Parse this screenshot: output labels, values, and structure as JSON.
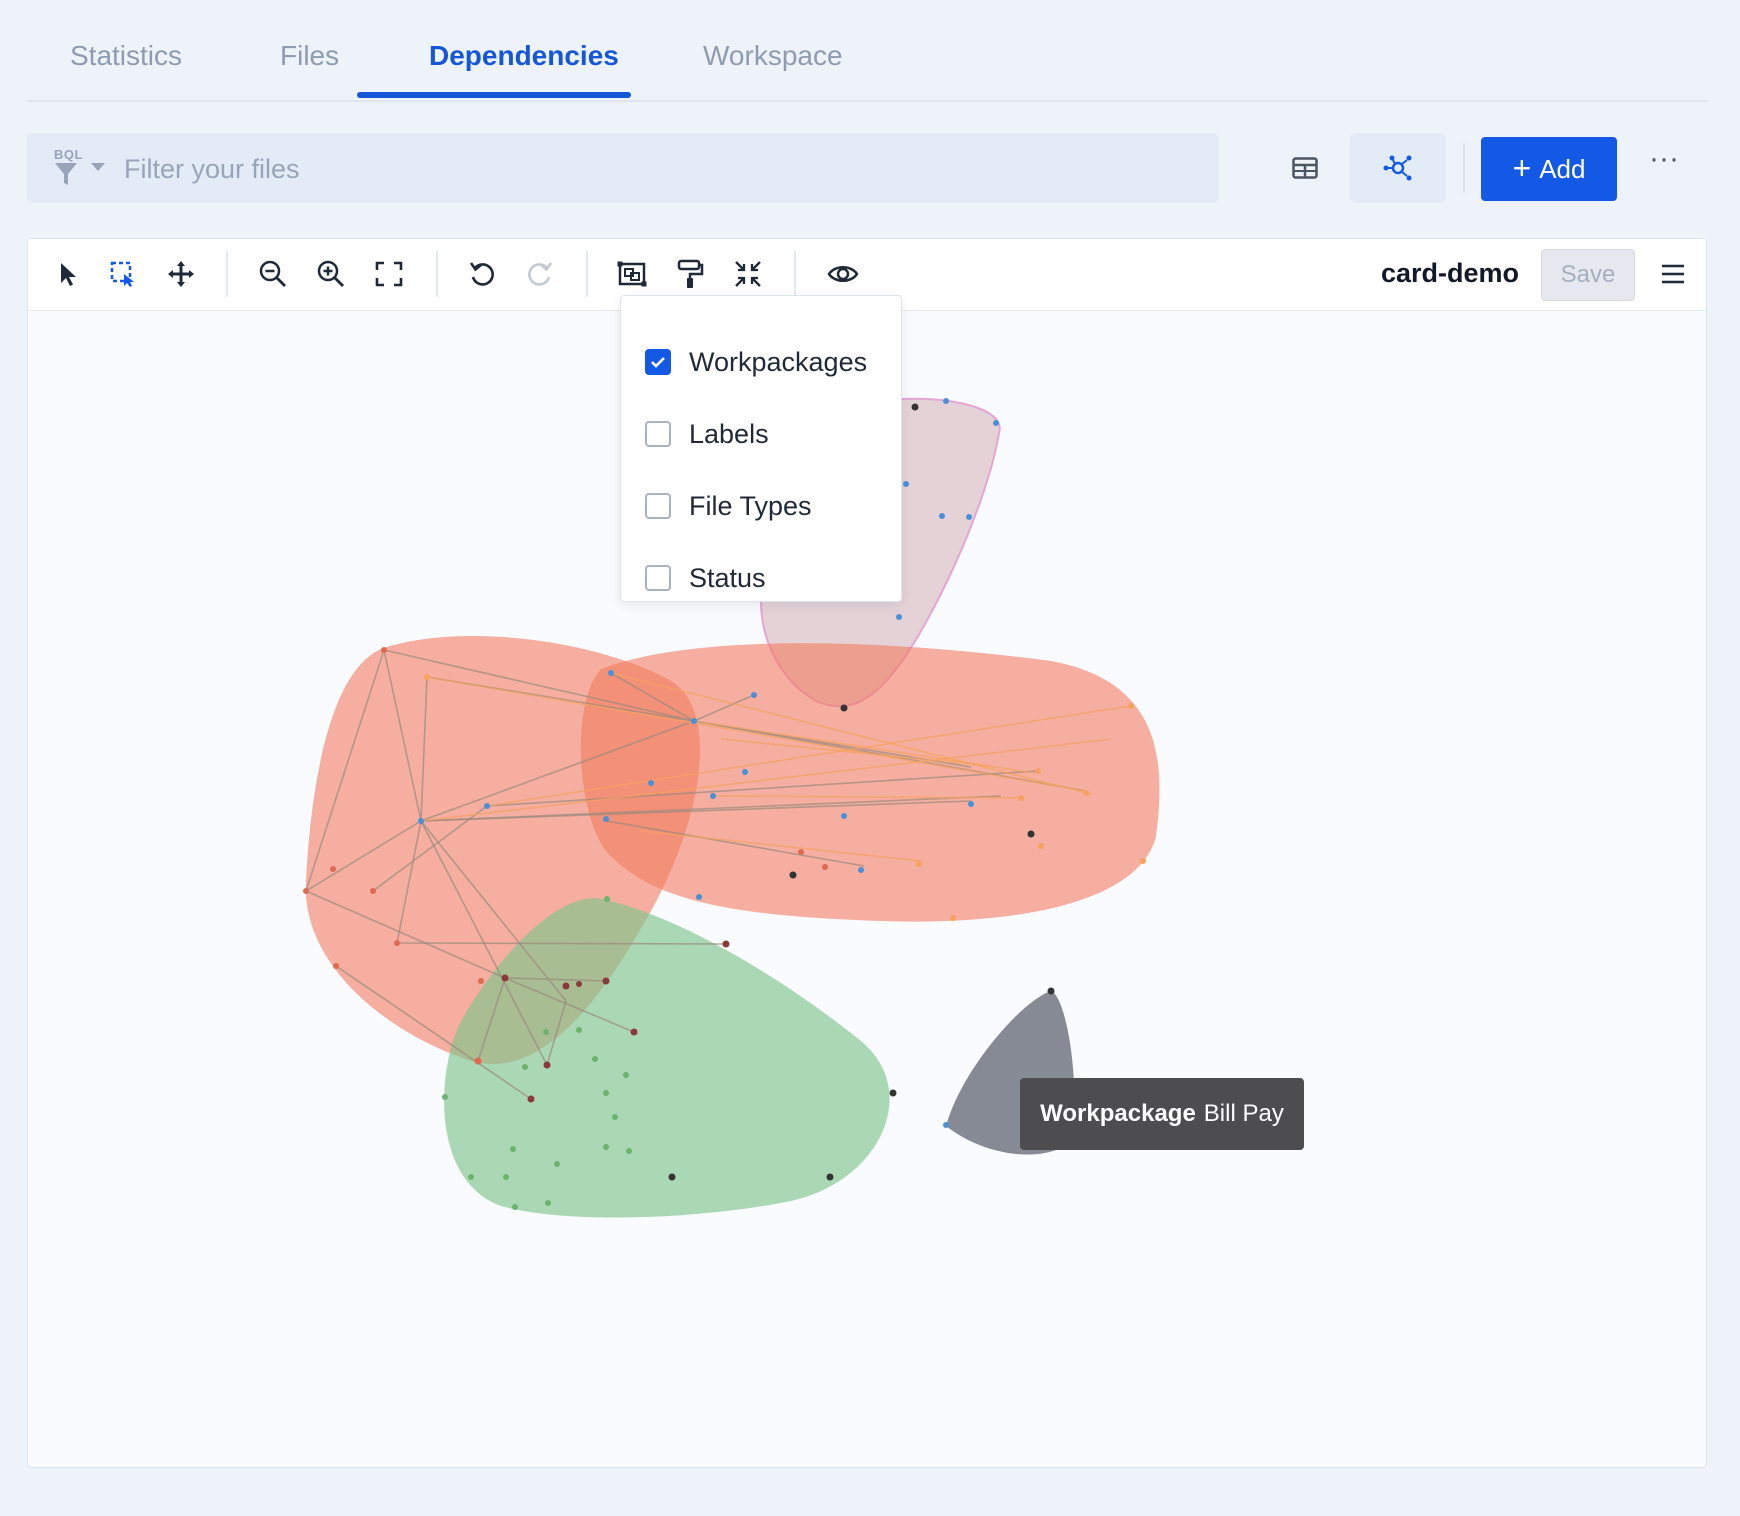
{
  "tabs": [
    {
      "label": "Statistics",
      "active": false
    },
    {
      "label": "Files",
      "active": false
    },
    {
      "label": "Dependencies",
      "active": true
    },
    {
      "label": "Workspace",
      "active": false
    }
  ],
  "filter": {
    "bql_label": "BQL",
    "placeholder": "Filter your files"
  },
  "actions": {
    "add_label": "Add",
    "more_label": "···"
  },
  "canvas_toolbar": {
    "graph_name": "card-demo",
    "save_label": "Save",
    "save_enabled": false,
    "icons": [
      "select-icon",
      "box-select-icon",
      "pan-icon",
      "zoom-out-icon",
      "zoom-in-icon",
      "fit-view-icon",
      "undo-icon",
      "redo-icon",
      "group-icon",
      "paint-roller-icon",
      "collapse-icon",
      "eye-icon",
      "hamburger-menu-icon"
    ]
  },
  "view_dropdown": {
    "items": [
      {
        "label": "Workpackages",
        "checked": true
      },
      {
        "label": "Labels",
        "checked": false
      },
      {
        "label": "File Types",
        "checked": false
      },
      {
        "label": "Status",
        "checked": false
      }
    ]
  },
  "tooltip": {
    "kind": "Workpackage",
    "name": "Bill Pay"
  },
  "colors": {
    "accent": "#1459e6",
    "cluster_orange": "#f27c5f",
    "cluster_green": "#7fc48e",
    "cluster_pink": "#c9a0a8",
    "cluster_gray": "#5d6470"
  }
}
